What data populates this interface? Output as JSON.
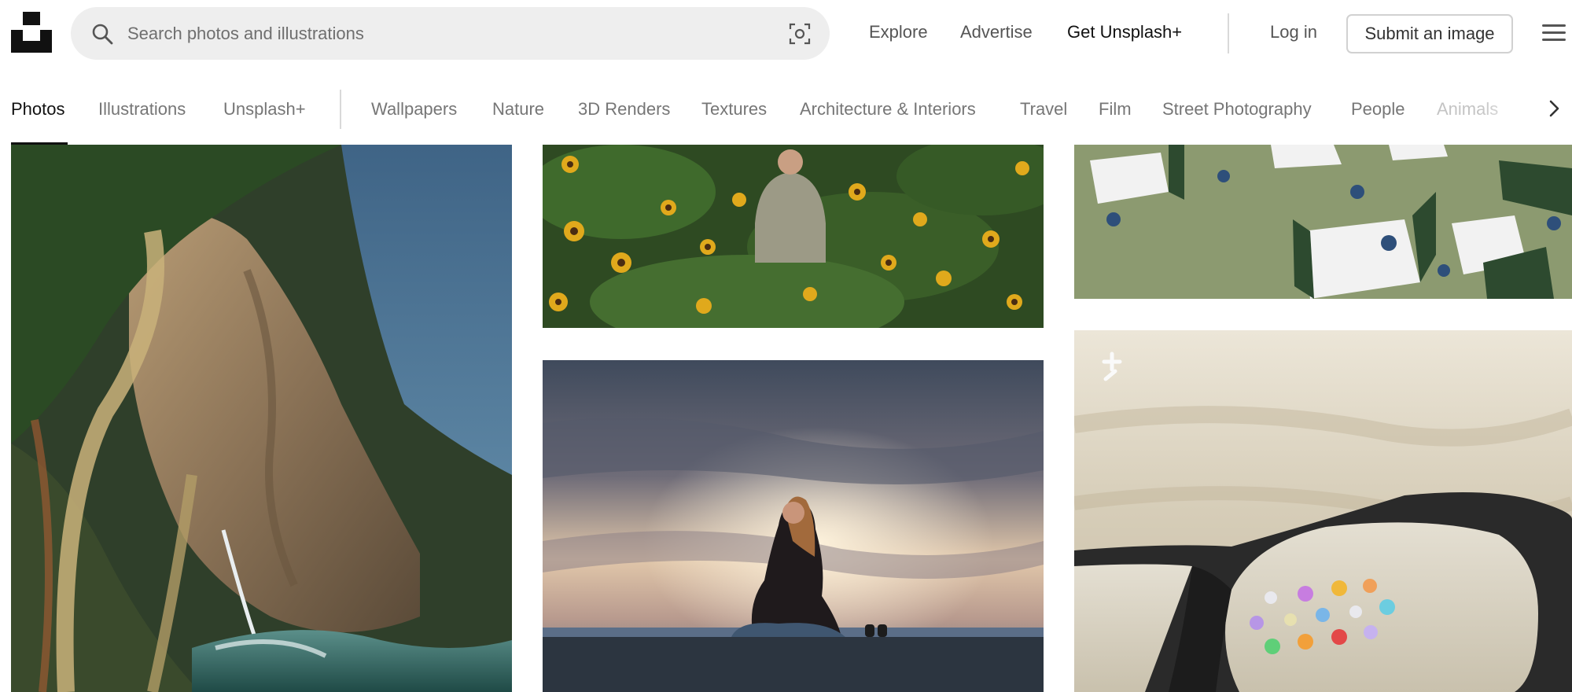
{
  "header": {
    "search_placeholder": "Search photos and illustrations",
    "nav": {
      "explore": "Explore",
      "advertise": "Advertise",
      "get_plus": "Get Unsplash+"
    },
    "login": "Log in",
    "submit": "Submit an image"
  },
  "tabs": {
    "items": [
      "Photos",
      "Illustrations",
      "Unsplash+",
      "Wallpapers",
      "Nature",
      "3D Renders",
      "Textures",
      "Architecture & Interiors",
      "Travel",
      "Film",
      "Street Photography",
      "People",
      "Animals"
    ],
    "active": "Photos"
  },
  "icons": {
    "logo": "unsplash-logo",
    "search": "search-icon",
    "visual_search": "visual-search-icon",
    "menu": "hamburger-menu-icon",
    "next": "chevron-right-icon"
  },
  "colors": {
    "accent": "#111111",
    "muted": "#767676",
    "search_bg": "#eeeeee"
  }
}
